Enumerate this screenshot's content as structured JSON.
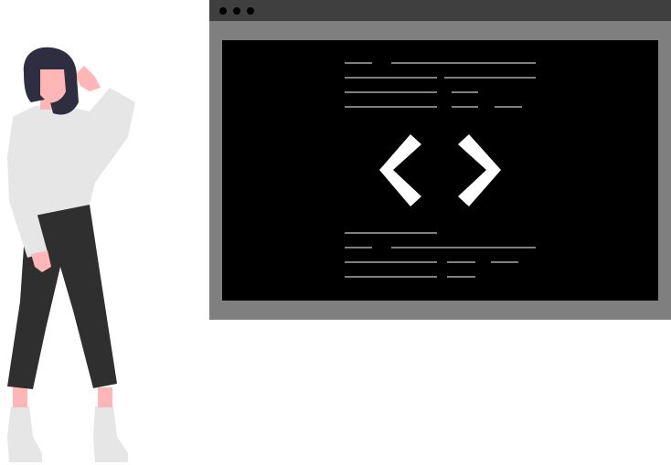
{
  "illustration": {
    "icons": {
      "code": "code-brackets-icon",
      "window_dots": "traffic-light-dots"
    },
    "colors": {
      "background": "#ffffff",
      "window_chrome": "#3f3f3f",
      "window_frame": "#7f7f7f",
      "screen": "#000000",
      "code_lines": "#7f7f7f",
      "brackets": "#ffffff",
      "person_skin": "#ffb6b6",
      "person_hair": "#2f2e41",
      "person_sweater": "#e6e6e6",
      "person_pants": "#2f2f2f",
      "person_shoes": "#e6e6e6"
    }
  }
}
